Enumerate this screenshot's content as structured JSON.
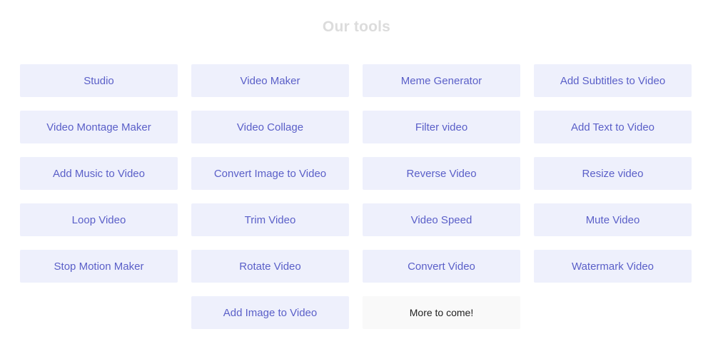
{
  "section": {
    "title": "Our tools"
  },
  "tools": [
    {
      "label": "Studio"
    },
    {
      "label": "Video Maker"
    },
    {
      "label": "Meme Generator"
    },
    {
      "label": "Add Subtitles to Video"
    },
    {
      "label": "Video Montage Maker"
    },
    {
      "label": "Video Collage"
    },
    {
      "label": "Filter video"
    },
    {
      "label": "Add Text to Video"
    },
    {
      "label": "Add Music to Video"
    },
    {
      "label": "Convert Image to Video"
    },
    {
      "label": "Reverse Video"
    },
    {
      "label": "Resize video"
    },
    {
      "label": "Loop Video"
    },
    {
      "label": "Trim Video"
    },
    {
      "label": "Video Speed"
    },
    {
      "label": "Mute Video"
    },
    {
      "label": "Stop Motion Maker"
    },
    {
      "label": "Rotate Video"
    },
    {
      "label": "Convert Video"
    },
    {
      "label": "Watermark Video"
    },
    {
      "label": "Add Image to Video"
    }
  ],
  "more": {
    "label": "More to come!"
  },
  "colors": {
    "button_bg": "#eef0fc",
    "button_text": "#5a5fc8",
    "heading": "#dcdcdc",
    "more_bg": "#f9f9f9"
  }
}
